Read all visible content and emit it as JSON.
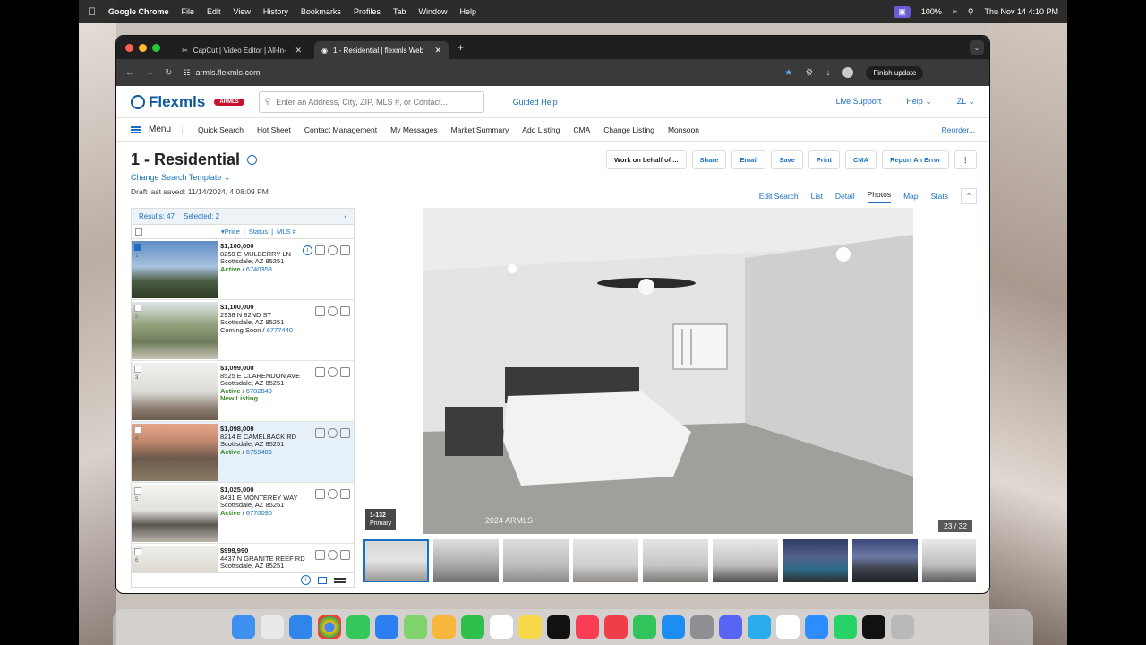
{
  "menubar": {
    "app": "Google Chrome",
    "items": [
      "File",
      "Edit",
      "View",
      "History",
      "Bookmarks",
      "Profiles",
      "Tab",
      "Window",
      "Help"
    ],
    "battery": "100%",
    "datetime": "Thu Nov 14  4:10 PM"
  },
  "browser": {
    "tabs": [
      {
        "label": "CapCut | Video Editor | All-In-"
      },
      {
        "label": "1 - Residential | flexmls Web"
      }
    ],
    "url": "armls.flexmls.com",
    "finish_update": "Finish update",
    "profile": "ZI"
  },
  "header": {
    "logo": "Flexmls",
    "armls_badge": "ARMLS",
    "search_placeholder": "Enter an Address, City, ZIP, MLS #, or Contact...",
    "guided_help": "Guided Help",
    "live_support": "Live Support",
    "help": "Help",
    "user": "ZL"
  },
  "nav": {
    "menu": "Menu",
    "items": [
      "Quick Search",
      "Hot Sheet",
      "Contact Management",
      "My Messages",
      "Market Summary",
      "Add Listing",
      "CMA",
      "Change Listing",
      "Monsoon"
    ],
    "reorder": "Reorder..."
  },
  "page": {
    "title": "1 - Residential",
    "change_template": "Change Search Template",
    "draft": "Draft last saved: 11/14/2024, 4:08:09 PM",
    "actions": [
      "Work on behalf of ...",
      "Share",
      "Email",
      "Save",
      "Print",
      "CMA",
      "Report An Error"
    ],
    "views": [
      "Edit Search",
      "List",
      "Detail",
      "Photos",
      "Map",
      "Stats"
    ],
    "selected_view": "Photos"
  },
  "results": {
    "count": "Results: 47",
    "selected": "Selected: 2",
    "columns": [
      "Price",
      "Status",
      "MLS #"
    ],
    "rows": [
      {
        "num": "1",
        "price": "$1,100,000",
        "addr": "8259 E MULBERRY LN",
        "city": "Scottsdale, AZ 85251",
        "status": "Active",
        "mls": "6740353",
        "extra": ""
      },
      {
        "num": "2",
        "price": "$1,100,000",
        "addr": "2938 N 82ND ST",
        "city": "Scottsdale, AZ 85251",
        "status": "Coming Soon",
        "mls": "6777440",
        "extra": ""
      },
      {
        "num": "3",
        "price": "$1,099,000",
        "addr": "8525 E CLARENDON AVE",
        "city": "Scottsdale, AZ 85251",
        "status": "Active",
        "mls": "6782849",
        "extra": "New Listing"
      },
      {
        "num": "4",
        "price": "$1,098,000",
        "addr": "8214 E CAMELBACK RD",
        "city": "Scottsdale, AZ 85251",
        "status": "Active",
        "mls": "6759486",
        "extra": ""
      },
      {
        "num": "5",
        "price": "$1,025,000",
        "addr": "8431 E MONTEREY WAY",
        "city": "Scottsdale, AZ 85251",
        "status": "Active",
        "mls": "6770090",
        "extra": ""
      },
      {
        "num": "6",
        "price": "$999,990",
        "addr": "4437 N GRANITE REEF RD",
        "city": "Scottsdale, AZ 85251",
        "status": "",
        "mls": "",
        "extra": ""
      }
    ]
  },
  "photo": {
    "tag_line1": "1-132",
    "tag_line2": "Primary",
    "watermark": "2024 ARMLS",
    "counter": "23 / 32"
  }
}
